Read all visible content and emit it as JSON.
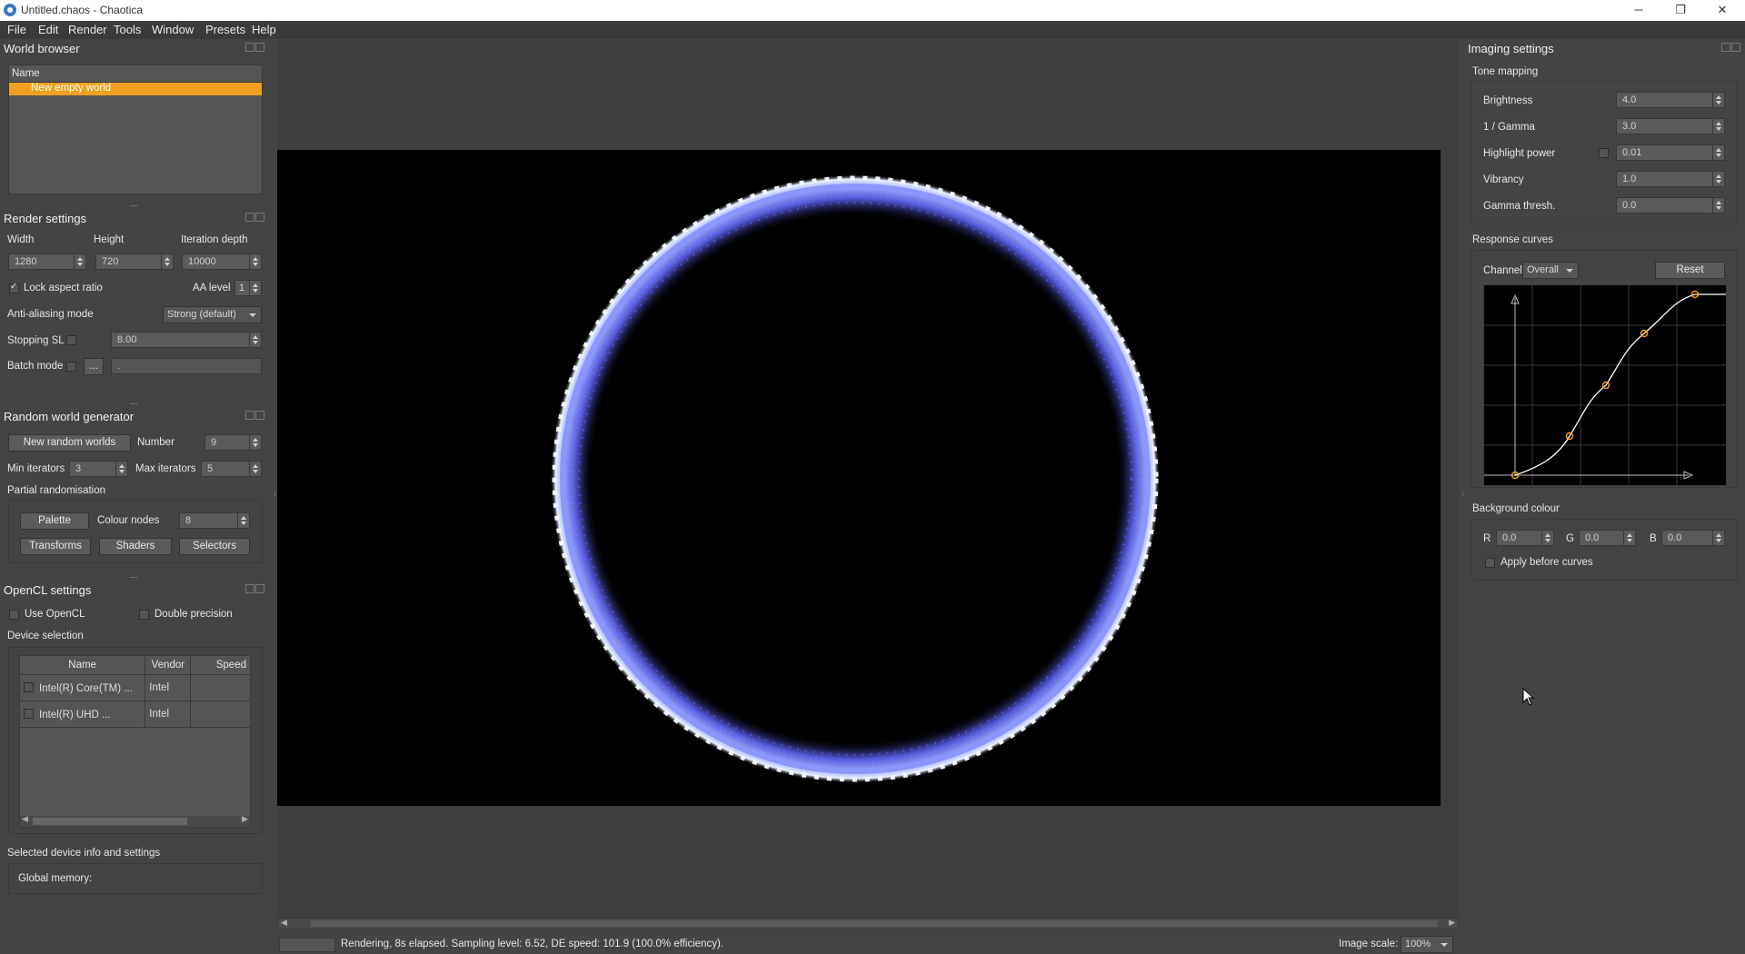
{
  "window": {
    "title": "Untitled.chaos - Chaotica",
    "minimize_icon": "minimize-icon",
    "maximize_icon": "restore-icon",
    "close_icon": "close-icon"
  },
  "menu": [
    "File",
    "Edit",
    "Render",
    "Tools",
    "Window",
    "Presets",
    "Help"
  ],
  "world_browser": {
    "title": "World browser",
    "column_name": "Name",
    "selected_world": "New empty world",
    "accent": "#f0a020"
  },
  "render_settings": {
    "title": "Render settings",
    "width_label": "Width",
    "height_label": "Height",
    "depth_label": "Iteration depth",
    "width": "1280",
    "height": "720",
    "depth": "10000",
    "lock_aspect_label": "Lock aspect ratio",
    "aa_level_label": "AA level",
    "aa_level": "1",
    "aa_mode_label": "Anti-aliasing mode",
    "aa_mode": "Strong (default)",
    "stopping_sl_label": "Stopping SL",
    "stopping_sl": "8.00",
    "batch_mode_label": "Batch mode",
    "batch_button": "...",
    "batch_path": "."
  },
  "random_world": {
    "title": "Random world generator",
    "new_button": "New random worlds",
    "number_label": "Number",
    "number": "9",
    "min_label": "Min iterators",
    "min": "3",
    "max_label": "Max iterators",
    "max": "5",
    "partial_label": "Partial randomisation",
    "palette_button": "Palette",
    "colour_nodes_label": "Colour nodes",
    "colour_nodes": "8",
    "transforms_button": "Transforms",
    "shaders_button": "Shaders",
    "selectors_button": "Selectors"
  },
  "opencl": {
    "title": "OpenCL settings",
    "use_label": "Use OpenCL",
    "double_label": "Double precision",
    "device_selection_label": "Device selection",
    "columns": [
      "Name",
      "Vendor",
      "Speed"
    ],
    "devices": [
      {
        "name": "Intel(R) Core(TM) ...",
        "vendor": "Intel",
        "speed": ""
      },
      {
        "name": "Intel(R) UHD ...",
        "vendor": "Intel",
        "speed": ""
      }
    ],
    "selected_info_label": "Selected device info and settings",
    "global_memory_label": "Global memory:"
  },
  "imaging": {
    "title": "Imaging settings",
    "tone_mapping_label": "Tone mapping",
    "brightness_label": "Brightness",
    "brightness": "4.0",
    "gamma_label": "1 / Gamma",
    "gamma": "3.0",
    "highlight_label": "Highlight power",
    "highlight": "0.01",
    "vibrancy_label": "Vibrancy",
    "vibrancy": "1.0",
    "gamma_thresh_label": "Gamma thresh.",
    "gamma_thresh": "0.0",
    "response_curves_label": "Response curves",
    "channel_label": "Channel:",
    "channel": "Overall",
    "reset_button": "Reset",
    "background_label": "Background colour",
    "r_label": "R",
    "r": "0.0",
    "g_label": "G",
    "g": "0.0",
    "b_label": "B",
    "b": "0.0",
    "apply_before_label": "Apply before curves",
    "curve_color": "#f0a020"
  },
  "status": {
    "text": "Rendering, 8s elapsed. Sampling level: 6.52, DE speed: 101.9 (100.0% efficiency).",
    "image_scale_label": "Image scale:",
    "image_scale": "100%"
  }
}
